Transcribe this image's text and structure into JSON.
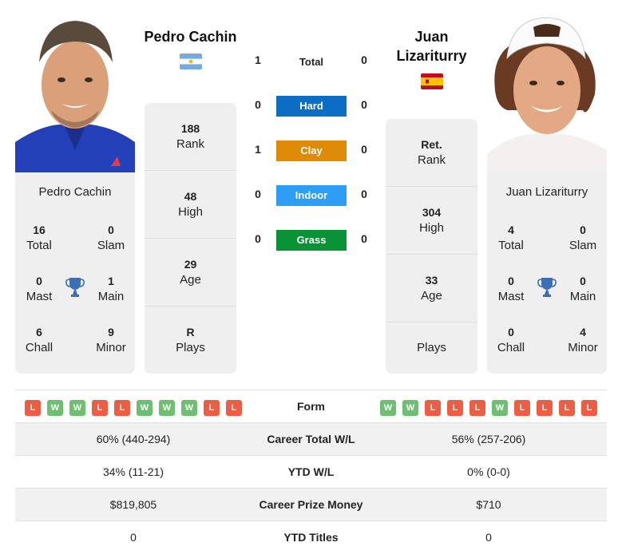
{
  "player1": {
    "name": "Pedro Cachin",
    "card_name": "Pedro Cachin",
    "country_flag": "argentina-flag",
    "photo": "player-photo-pedro-cachin",
    "titles": {
      "total": {
        "value": "16",
        "label": "Total"
      },
      "slam": {
        "value": "0",
        "label": "Slam"
      },
      "mast": {
        "value": "0",
        "label": "Mast"
      },
      "main": {
        "value": "1",
        "label": "Main"
      },
      "chall": {
        "value": "6",
        "label": "Chall"
      },
      "minor": {
        "value": "9",
        "label": "Minor"
      }
    },
    "info": [
      {
        "value": "188",
        "label": "Rank"
      },
      {
        "value": "48",
        "label": "High"
      },
      {
        "value": "29",
        "label": "Age"
      },
      {
        "value": "R",
        "label": "Plays"
      }
    ],
    "form": [
      "L",
      "W",
      "W",
      "L",
      "L",
      "W",
      "W",
      "W",
      "L",
      "L"
    ]
  },
  "player2": {
    "name": "Juan Lizariturry",
    "name_line1": "Juan",
    "name_line2": "Lizariturry",
    "card_name": "Juan Lizariturry",
    "country_flag": "spain-flag",
    "photo": "player-photo-juan-lizariturry",
    "titles": {
      "total": {
        "value": "4",
        "label": "Total"
      },
      "slam": {
        "value": "0",
        "label": "Slam"
      },
      "mast": {
        "value": "0",
        "label": "Mast"
      },
      "main": {
        "value": "0",
        "label": "Main"
      },
      "chall": {
        "value": "0",
        "label": "Chall"
      },
      "minor": {
        "value": "4",
        "label": "Minor"
      }
    },
    "info": [
      {
        "value": "Ret.",
        "label": "Rank"
      },
      {
        "value": "304",
        "label": "High"
      },
      {
        "value": "33",
        "label": "Age"
      },
      {
        "value": "",
        "label": "Plays"
      }
    ],
    "form": [
      "W",
      "W",
      "L",
      "L",
      "L",
      "W",
      "L",
      "L",
      "L",
      "L"
    ]
  },
  "h2h": {
    "total": {
      "label": "Total",
      "p1": "1",
      "p2": "0"
    },
    "surfaces": [
      {
        "label": "Hard",
        "p1": "0",
        "p2": "0",
        "color": "#0d6cc4"
      },
      {
        "label": "Clay",
        "p1": "1",
        "p2": "0",
        "color": "#de8c07"
      },
      {
        "label": "Indoor",
        "p1": "0",
        "p2": "0",
        "color": "#2e9ef4"
      },
      {
        "label": "Grass",
        "p1": "0",
        "p2": "0",
        "color": "#0a9236"
      }
    ]
  },
  "form_label": "Form",
  "comparison": [
    {
      "label": "Career Total W/L",
      "p1": "60% (440-294)",
      "p2": "56% (257-206)"
    },
    {
      "label": "YTD W/L",
      "p1": "34% (11-21)",
      "p2": "0% (0-0)"
    },
    {
      "label": "Career Prize Money",
      "p1": "$819,805",
      "p2": "$710"
    },
    {
      "label": "YTD Titles",
      "p1": "0",
      "p2": "0"
    }
  ],
  "colors": {
    "win": "#6fbf73",
    "loss": "#ec5d44",
    "trophy": "#3a6fb5",
    "card_bg": "#efefef"
  }
}
